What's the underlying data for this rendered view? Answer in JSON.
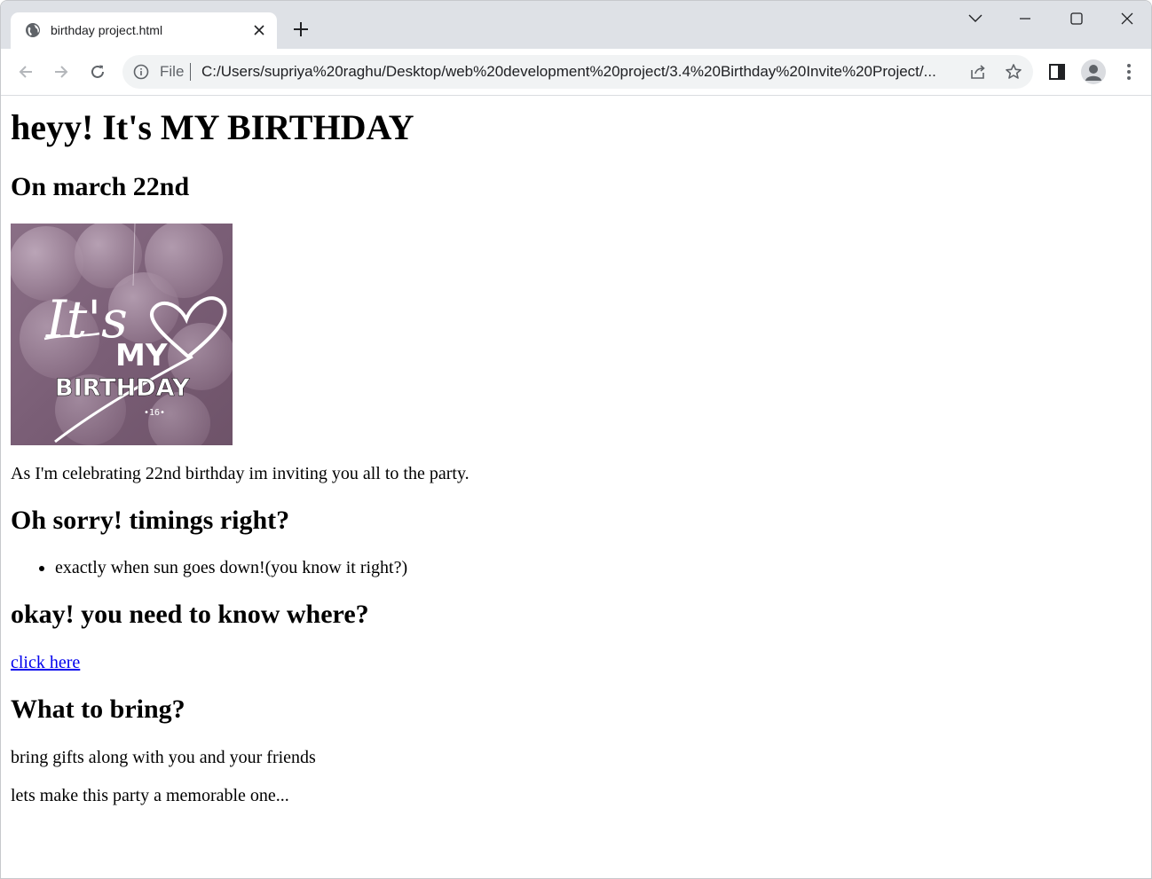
{
  "browser": {
    "tab": {
      "title": "birthday project.html"
    },
    "omnibox": {
      "scheme_label": "File",
      "url": "C:/Users/supriya%20raghu/Desktop/web%20development%20project/3.4%20Birthday%20Invite%20Project/..."
    },
    "icons": {
      "favicon": "globe-icon",
      "close_tab": "close-icon",
      "new_tab": "plus-icon",
      "tab_search": "chevron-down-icon",
      "minimize": "minimize-icon",
      "maximize": "maximize-icon",
      "close_window": "close-icon",
      "back": "arrow-left-icon",
      "forward": "arrow-right-icon",
      "reload": "reload-icon",
      "site_info": "info-icon",
      "share": "share-icon",
      "bookmark": "star-icon",
      "side_panel": "side-panel-icon",
      "profile": "avatar-icon",
      "menu": "kebab-menu-icon"
    }
  },
  "page": {
    "heading": "heyy! It's MY BIRTHDAY",
    "date_heading": "On march 22nd",
    "image": {
      "text_its": "It's",
      "text_my": "MY",
      "text_birthday": "BIRTHDAY",
      "text_number": "•16•",
      "colors": {
        "background": "#7d6178",
        "balloon": "#a98fa6",
        "text": "#ffffff"
      }
    },
    "intro_text": "As I'm celebrating 22nd birthday im inviting you all to the party.",
    "timing_heading": "Oh sorry! timings right?",
    "timing_items": [
      "exactly when sun goes down!(you know it right?)"
    ],
    "location_heading": "okay! you need to know where?",
    "location_link": "click here",
    "bring_heading": "What to bring?",
    "bring_text": "bring gifts along with you and your friends",
    "closing_text": "lets make this party a memorable one..."
  }
}
